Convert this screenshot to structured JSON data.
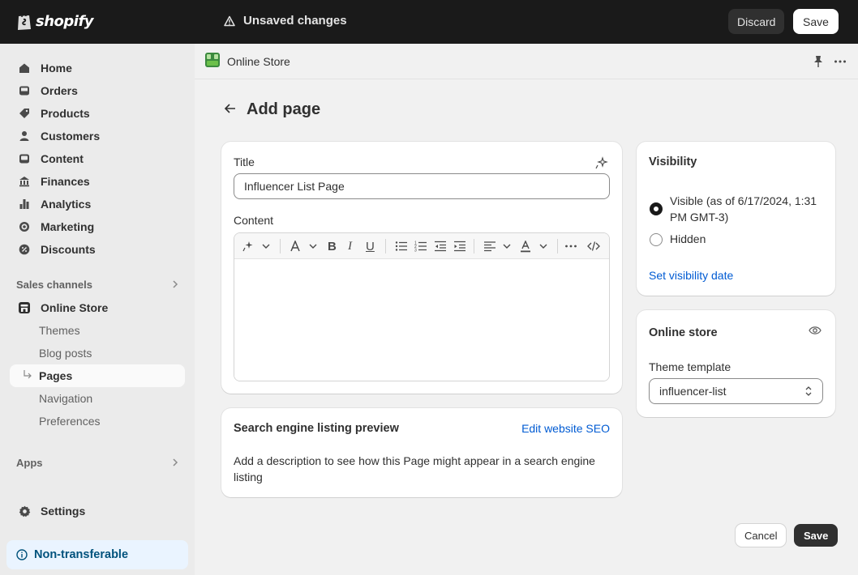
{
  "topbar": {
    "brand": "shopify",
    "unsaved_text": "Unsaved changes",
    "discard_label": "Discard",
    "save_label": "Save"
  },
  "sidebar": {
    "items": [
      {
        "label": "Home",
        "icon": "home-icon"
      },
      {
        "label": "Orders",
        "icon": "inbox-icon"
      },
      {
        "label": "Products",
        "icon": "tag-icon"
      },
      {
        "label": "Customers",
        "icon": "person-icon"
      },
      {
        "label": "Content",
        "icon": "image-icon"
      },
      {
        "label": "Finances",
        "icon": "bank-icon"
      },
      {
        "label": "Analytics",
        "icon": "bar-chart-icon"
      },
      {
        "label": "Marketing",
        "icon": "target-icon"
      },
      {
        "label": "Discounts",
        "icon": "discount-icon"
      }
    ],
    "sales_channels_label": "Sales channels",
    "online_store_label": "Online Store",
    "sub_items": [
      "Themes",
      "Blog posts",
      "Pages",
      "Navigation",
      "Preferences"
    ],
    "apps_label": "Apps",
    "settings_label": "Settings",
    "nontransferable_label": "Non-transferable"
  },
  "appbar": {
    "title": "Online Store"
  },
  "page": {
    "title": "Add page"
  },
  "form": {
    "title_label": "Title",
    "title_value": "Influencer List Page",
    "content_label": "Content"
  },
  "seo": {
    "title": "Search engine listing preview",
    "edit_link": "Edit website SEO",
    "description": "Add a description to see how this Page might appear in a search engine listing"
  },
  "visibility": {
    "title": "Visibility",
    "visible_label": "Visible (as of 6/17/2024, 1:31 PM GMT-3)",
    "hidden_label": "Hidden",
    "selected": "visible",
    "set_date_link": "Set visibility date"
  },
  "online_store_card": {
    "title": "Online store",
    "template_label": "Theme template",
    "template_value": "influencer-list"
  },
  "footer": {
    "cancel_label": "Cancel",
    "save_label": "Save"
  },
  "colors": {
    "topbar_bg": "#1a1a1a",
    "link": "#005bd3",
    "nontransferable_bg": "#eaf4ff",
    "nontransferable_text": "#00527c"
  }
}
